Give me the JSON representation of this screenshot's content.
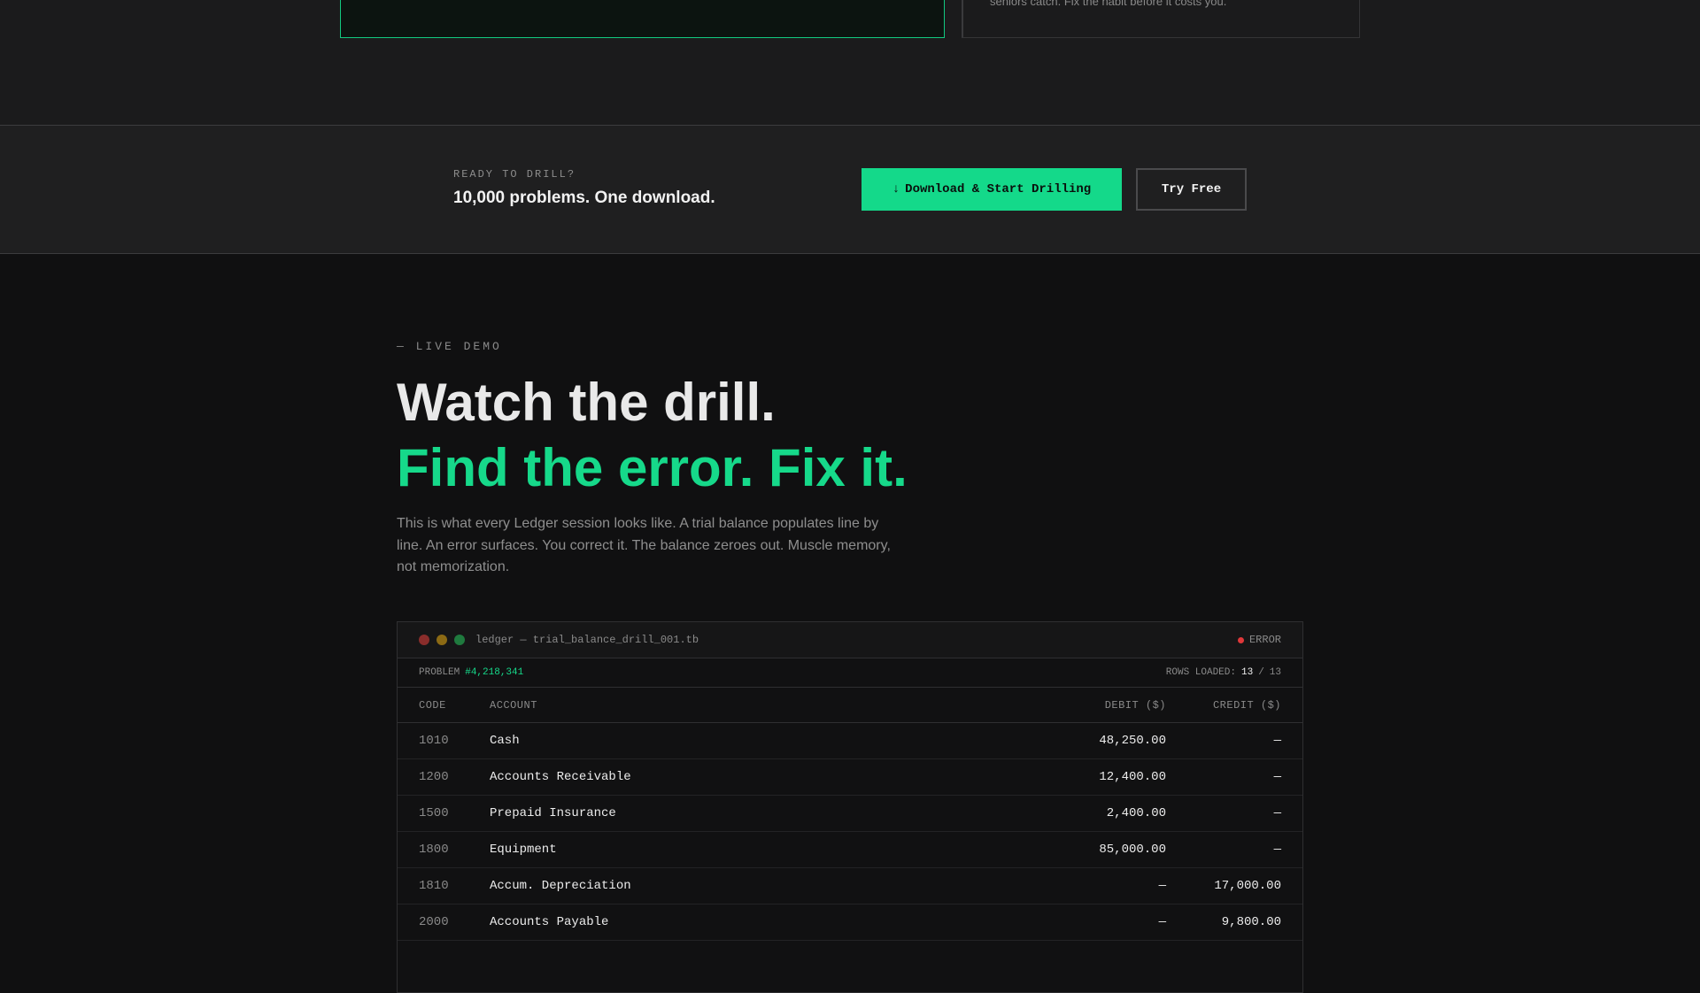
{
  "top": {
    "tip_text": "seniors catch. Fix the habit before it costs you."
  },
  "cta": {
    "eyebrow": "READY TO DRILL?",
    "title": "10,000 problems. One download.",
    "download_icon": "↓",
    "primary_label": "Download & Start Drilling",
    "secondary_label": "Try Free"
  },
  "demo": {
    "eyebrow": "— LIVE DEMO",
    "title_line1": "Watch the drill.",
    "title_line2": "Find the error. Fix it.",
    "description": "This is what every Ledger session looks like. A trial balance populates line by line. An error surfaces. You correct it. The balance zeroes out. Muscle memory, not memorization."
  },
  "ledger": {
    "filename": "ledger — trial_balance_drill_001.tb",
    "status": "ERROR",
    "status_color": "#e0383a",
    "problem_label": "PROBLEM",
    "problem_number": "#4,218,341",
    "rows_label": "ROWS LOADED:",
    "rows_loaded": "13",
    "rows_total": "13",
    "columns": {
      "code": "CODE",
      "account": "ACCOUNT",
      "debit": "DEBIT ($)",
      "credit": "CREDIT ($)"
    },
    "rows": [
      {
        "code": "1010",
        "account": "Cash",
        "debit": "48,250.00",
        "credit": "—"
      },
      {
        "code": "1200",
        "account": "Accounts Receivable",
        "debit": "12,400.00",
        "credit": "—"
      },
      {
        "code": "1500",
        "account": "Prepaid Insurance",
        "debit": "2,400.00",
        "credit": "—"
      },
      {
        "code": "1800",
        "account": "Equipment",
        "debit": "85,000.00",
        "credit": "—"
      },
      {
        "code": "1810",
        "account": "Accum. Depreciation",
        "debit": "—",
        "credit": "17,000.00"
      },
      {
        "code": "2000",
        "account": "Accounts Payable",
        "debit": "—",
        "credit": "9,800.00"
      }
    ]
  },
  "colors": {
    "accent": "#16d98a",
    "background": "#101011",
    "error": "#e0383a"
  }
}
